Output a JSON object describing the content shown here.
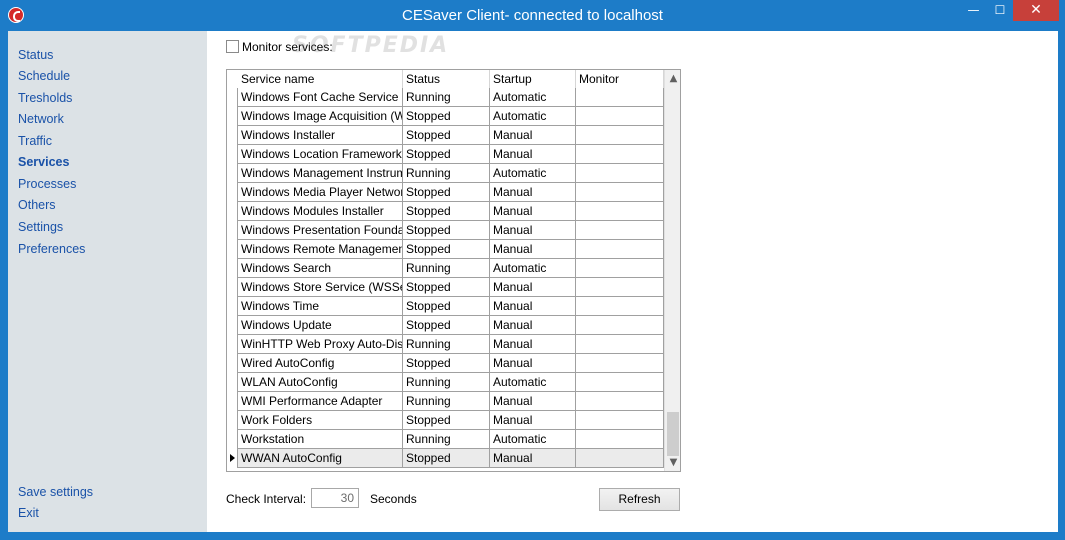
{
  "window": {
    "title": "CESaver Client- connected to localhost",
    "minimize_symbol": "—",
    "maximize_symbol": "☐",
    "close_symbol": "✕",
    "accent_color": "#1d7cc8"
  },
  "sidebar": {
    "items": [
      {
        "label": "Status",
        "active": false
      },
      {
        "label": "Schedule",
        "active": false
      },
      {
        "label": "Tresholds",
        "active": false
      },
      {
        "label": "Network",
        "active": false
      },
      {
        "label": "Traffic",
        "active": false
      },
      {
        "label": "Services",
        "active": true
      },
      {
        "label": "Processes",
        "active": false
      },
      {
        "label": "Others",
        "active": false
      },
      {
        "label": "Settings",
        "active": false
      },
      {
        "label": "Preferences",
        "active": false
      }
    ],
    "bottom_items": [
      {
        "label": "Save settings"
      },
      {
        "label": "Exit"
      }
    ]
  },
  "monitor": {
    "label": "Monitor services:",
    "checked": false
  },
  "watermark": "SOFTPEDIA",
  "grid": {
    "columns": [
      "Service name",
      "Status",
      "Startup",
      "Monitor"
    ],
    "rows": [
      {
        "name": "Windows Font Cache Service",
        "status": "Running",
        "startup": "Automatic",
        "monitor": ""
      },
      {
        "name": "Windows Image Acquisition (WIA)",
        "status": "Stopped",
        "startup": "Automatic",
        "monitor": ""
      },
      {
        "name": "Windows Installer",
        "status": "Stopped",
        "startup": "Manual",
        "monitor": ""
      },
      {
        "name": "Windows Location Framework",
        "status": "Stopped",
        "startup": "Manual",
        "monitor": ""
      },
      {
        "name": "Windows Management Instrumentation",
        "status": "Running",
        "startup": "Automatic",
        "monitor": ""
      },
      {
        "name": "Windows Media Player Network",
        "status": "Stopped",
        "startup": "Manual",
        "monitor": ""
      },
      {
        "name": "Windows Modules Installer",
        "status": "Stopped",
        "startup": "Manual",
        "monitor": ""
      },
      {
        "name": "Windows Presentation Foundation",
        "status": "Stopped",
        "startup": "Manual",
        "monitor": ""
      },
      {
        "name": "Windows Remote Management",
        "status": "Stopped",
        "startup": "Manual",
        "monitor": ""
      },
      {
        "name": "Windows Search",
        "status": "Running",
        "startup": "Automatic",
        "monitor": ""
      },
      {
        "name": "Windows Store Service (WSService)",
        "status": "Stopped",
        "startup": "Manual",
        "monitor": ""
      },
      {
        "name": "Windows Time",
        "status": "Stopped",
        "startup": "Manual",
        "monitor": ""
      },
      {
        "name": "Windows Update",
        "status": "Stopped",
        "startup": "Manual",
        "monitor": ""
      },
      {
        "name": "WinHTTP Web Proxy Auto-Discovery",
        "status": "Running",
        "startup": "Manual",
        "monitor": ""
      },
      {
        "name": "Wired AutoConfig",
        "status": "Stopped",
        "startup": "Manual",
        "monitor": ""
      },
      {
        "name": "WLAN AutoConfig",
        "status": "Running",
        "startup": "Automatic",
        "monitor": ""
      },
      {
        "name": "WMI Performance Adapter",
        "status": "Running",
        "startup": "Manual",
        "monitor": ""
      },
      {
        "name": "Work Folders",
        "status": "Stopped",
        "startup": "Manual",
        "monitor": ""
      },
      {
        "name": "Workstation",
        "status": "Running",
        "startup": "Automatic",
        "monitor": ""
      },
      {
        "name": "WWAN AutoConfig",
        "status": "Stopped",
        "startup": "Manual",
        "monitor": "",
        "selected": true
      }
    ],
    "scroll_up_symbol": "▲",
    "scroll_down_symbol": "▼",
    "scroll_position_fraction": 1.0
  },
  "interval": {
    "label": "Check Interval:",
    "value": "30",
    "unit": "Seconds"
  },
  "refresh_label": "Refresh"
}
